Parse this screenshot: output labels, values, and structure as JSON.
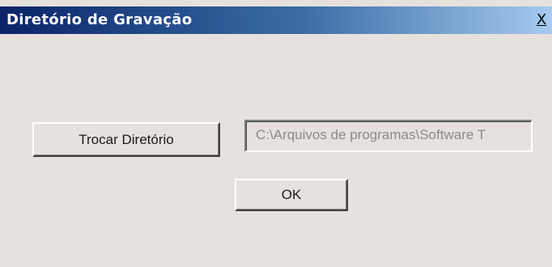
{
  "window": {
    "title": "Diretório de Gravação",
    "close_label": "X"
  },
  "buttons": {
    "change_directory_label": "Trocar Diretório",
    "ok_label": "OK"
  },
  "path_field": {
    "value": "C:\\Arquivos de programas\\Software T",
    "disabled": true
  },
  "colors": {
    "face": "#e6e1dc",
    "title_start": "#0a246a",
    "title_end": "#a6caf0",
    "disabled_text": "#8a8a8a"
  }
}
